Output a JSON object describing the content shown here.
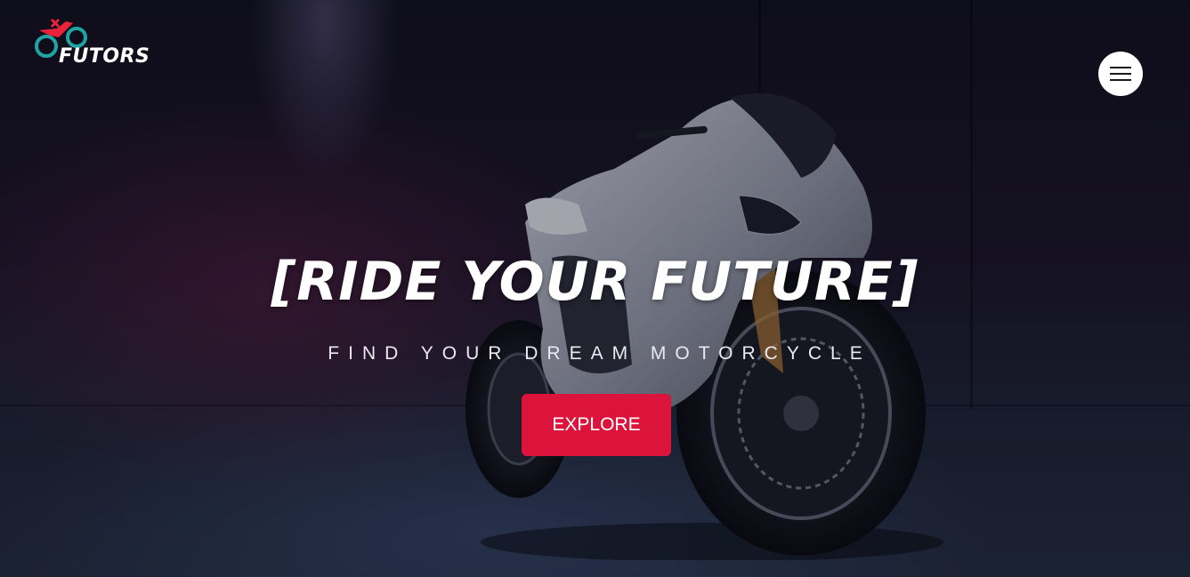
{
  "brand": {
    "name": "FUTORS"
  },
  "nav": {
    "menu_icon": "hamburger-icon"
  },
  "hero": {
    "headline": "[RIDE YOUR FUTURE]",
    "subheadline": "FIND YOUR DREAM MOTORCYCLE",
    "cta_label": "EXPLORE",
    "background_image": "motorcycle-photo"
  },
  "colors": {
    "accent": "#dc143c",
    "logo_red": "#e8233a",
    "logo_teal": "#1fa3a3",
    "text": "#ffffff"
  }
}
